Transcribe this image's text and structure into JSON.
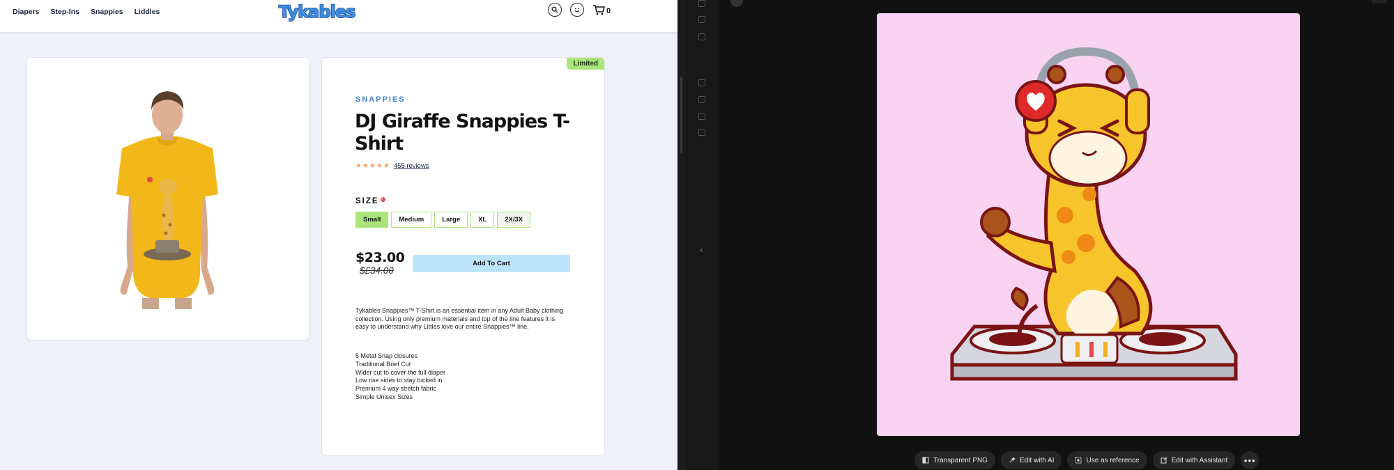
{
  "nav": {
    "items": [
      "Diapers",
      "Step-Ins",
      "Snappies",
      "Liddles"
    ]
  },
  "logo": {
    "text": "Tykables"
  },
  "header": {
    "cart_count": "0"
  },
  "product": {
    "badge": "Limited",
    "brand": "SNAPPIES",
    "title": "DJ Giraffe Snappies T-Shirt",
    "stars": "★★★★★",
    "reviews": "455 reviews",
    "size_label": "SIZE",
    "sizes": [
      "Small",
      "Medium",
      "Large",
      "XL",
      "2X/3X"
    ],
    "price": "$23.00",
    "old_price": "$£34.00",
    "add_to_cart": "Add To Cart",
    "description": " Tykables Snappies™ T-Shirt is an essential item in any Adult Baby clothing collection. Using only premium materials and top of the line features it is easy to understand why Littles love our entire Snappies™ line.",
    "features": [
      "5 Metal Snap closures",
      "Traditional Brief Cut",
      "Wider cut to cover the full diaper",
      "Low rise sides to stay tucked in",
      "Premium 4 way stretch fabric",
      "Simple Unisex Sizes"
    ]
  },
  "image_toolbar": {
    "buttons": [
      "Transparent PNG",
      "Edit with AI",
      "Use as reference",
      "Edit with Assistant"
    ],
    "more": "•••"
  },
  "colors": {
    "accent_green": "#a9e57a",
    "brand_blue": "#3d7fd0",
    "cart_button": "#bde3fb",
    "canvas_bg": "#fad3f3",
    "app_bg": "#111112"
  },
  "icons": [
    "search-icon",
    "smiley-face-icon",
    "cart-icon",
    "chevron-left-icon",
    "more-icon"
  ]
}
